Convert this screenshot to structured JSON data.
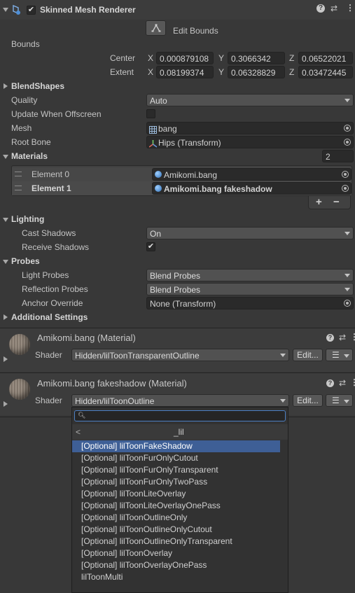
{
  "component": {
    "title": "Skinned Mesh Renderer",
    "edit_bounds_label": "Edit Bounds",
    "bounds_label": "Bounds",
    "center_label": "Center",
    "extent_label": "Extent",
    "center": {
      "x": "0.000879108",
      "y": "0.3066342",
      "z": "0.06522021"
    },
    "extent": {
      "x": "0.08199374",
      "y": "0.06328829",
      "z": "0.03472445"
    },
    "axis_x": "X",
    "axis_y": "Y",
    "axis_z": "Z",
    "blendshapes_label": "BlendShapes",
    "quality_label": "Quality",
    "quality_value": "Auto",
    "update_offscreen_label": "Update When Offscreen",
    "mesh_label": "Mesh",
    "mesh_value": "bang",
    "root_bone_label": "Root Bone",
    "root_bone_value": "Hips (Transform)",
    "materials_label": "Materials",
    "materials_count": "2",
    "materials": [
      {
        "label": "Element 0",
        "value": "Amikomi.bang"
      },
      {
        "label": "Element 1",
        "value": "Amikomi.bang fakeshadow"
      }
    ],
    "add_label": "+",
    "remove_label": "−",
    "lighting_label": "Lighting",
    "cast_shadows_label": "Cast Shadows",
    "cast_shadows_value": "On",
    "receive_shadows_label": "Receive Shadows",
    "probes_label": "Probes",
    "light_probes_label": "Light Probes",
    "light_probes_value": "Blend Probes",
    "reflection_probes_label": "Reflection Probes",
    "reflection_probes_value": "Blend Probes",
    "anchor_override_label": "Anchor Override",
    "anchor_override_value": "None (Transform)",
    "additional_settings_label": "Additional Settings"
  },
  "material1": {
    "title": "Amikomi.bang (Material)",
    "shader_label": "Shader",
    "shader_value": "Hidden/lilToonTransparentOutline",
    "edit_label": "Edit..."
  },
  "material2": {
    "title": "Amikomi.bang fakeshadow (Material)",
    "shader_label": "Shader",
    "shader_value": "Hidden/lilToonOutline",
    "edit_label": "Edit..."
  },
  "popup": {
    "search_value": "",
    "back_glyph": "<",
    "section_title": "_lil",
    "items": [
      "[Optional] lilToonFakeShadow",
      "[Optional] lilToonFurOnlyCutout",
      "[Optional] lilToonFurOnlyTransparent",
      "[Optional] lilToonFurOnlyTwoPass",
      "[Optional] lilToonLiteOverlay",
      "[Optional] lilToonLiteOverlayOnePass",
      "[Optional] lilToonOutlineOnly",
      "[Optional] lilToonOutlineOnlyCutout",
      "[Optional] lilToonOutlineOnlyTransparent",
      "[Optional] lilToonOverlay",
      "[Optional] lilToonOverlayOnePass",
      "lilToonMulti"
    ]
  },
  "colors": {
    "selection": "#3e5f96",
    "accent": "#7aa6e6"
  },
  "icons": [
    "collapse-arrow-icon",
    "component-icon",
    "help-icon",
    "presets-icon",
    "kebab-menu-icon",
    "edit-bounds-icon",
    "mesh-grid-icon",
    "bone-icon",
    "material-sphere-icon",
    "object-picker-icon",
    "search-icon",
    "list-icon"
  ]
}
